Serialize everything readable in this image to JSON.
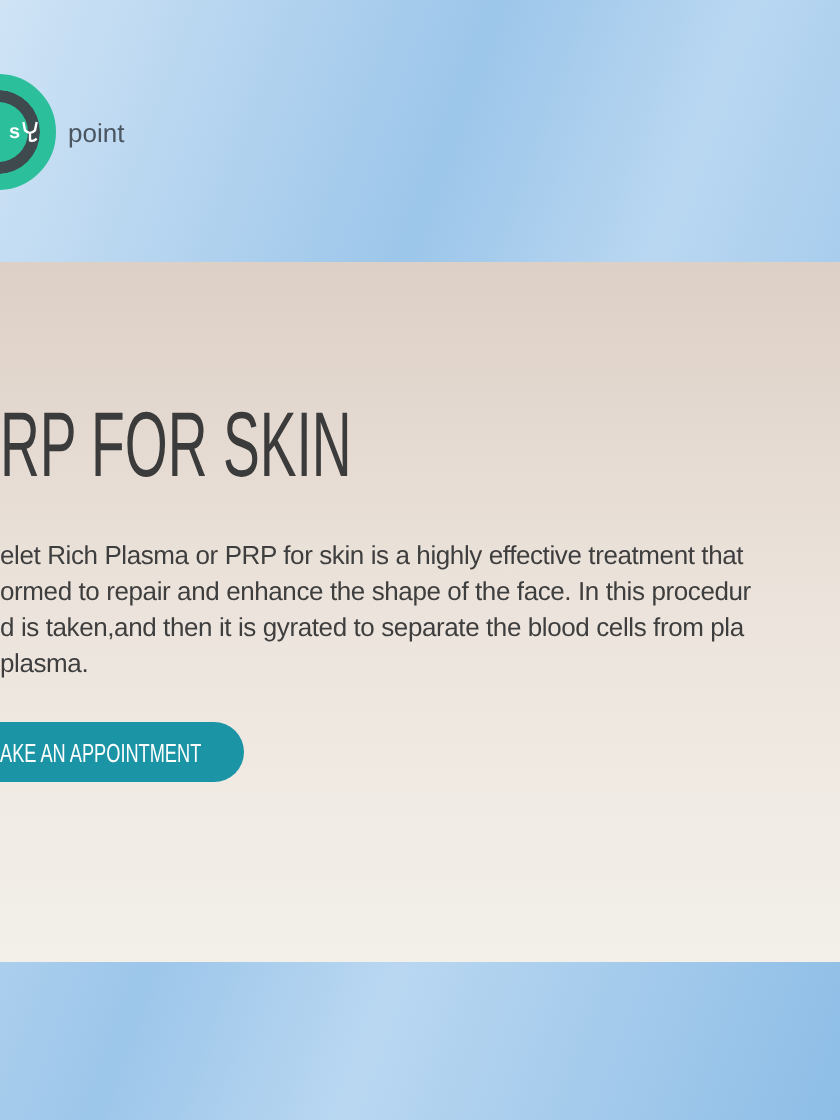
{
  "logo": {
    "letter": "s",
    "name": "point"
  },
  "hero": {
    "title": "RP FOR SKIN",
    "lines": [
      "elet Rich Plasma or PRP for skin is a highly effective treatment that",
      "ormed to repair and enhance the shape of the face. In this procedur",
      "d is taken,and then it is gyrated to separate the blood cells from pla",
      "plasma."
    ],
    "button": "AKE AN APPOINTMENT"
  }
}
